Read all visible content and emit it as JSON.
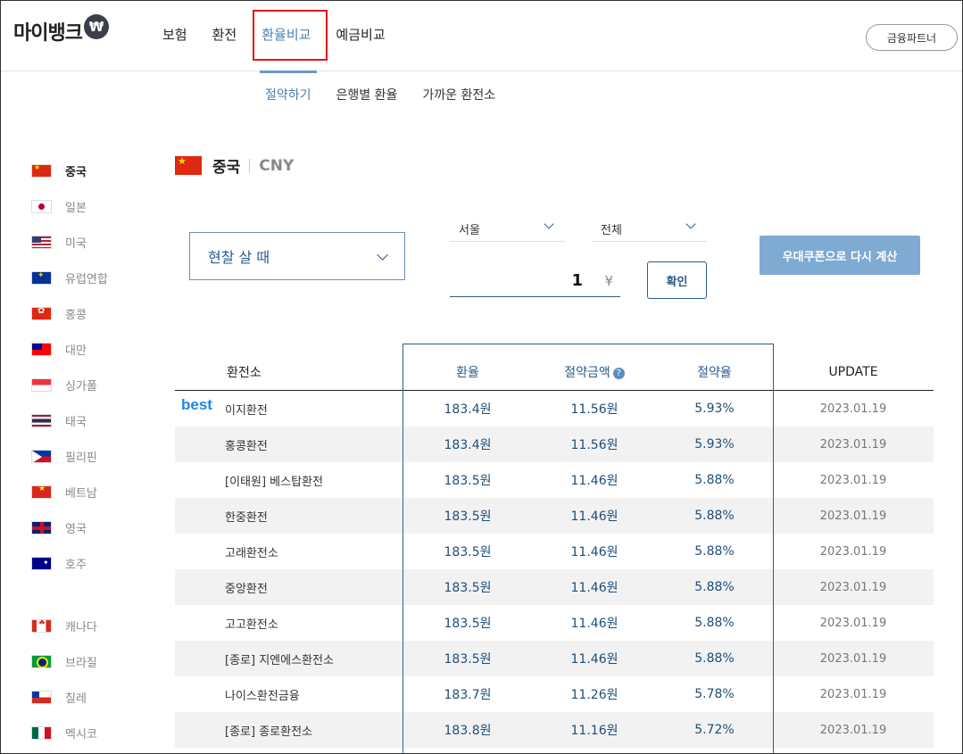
{
  "header": {
    "logo_text": "마이뱅크",
    "logo_badge": "₩",
    "nav": [
      "보험",
      "환전",
      "환율비교",
      "예금비교"
    ],
    "partner_label": "금융파트너"
  },
  "subnav": [
    "절약하기",
    "은행별 환율",
    "가까운 환전소"
  ],
  "sidebar": {
    "items": [
      {
        "label": "중국",
        "flag": "cn-flag"
      },
      {
        "label": "일본",
        "flag": "jp-flag"
      },
      {
        "label": "미국",
        "flag": "us-flag"
      },
      {
        "label": "유럽연합",
        "flag": "eu-flag"
      },
      {
        "label": "홍콩",
        "flag": "hk-flag"
      },
      {
        "label": "대만",
        "flag": "tw-flag"
      },
      {
        "label": "싱가폴",
        "flag": "sg-flag"
      },
      {
        "label": "태국",
        "flag": "th-flag"
      },
      {
        "label": "필리핀",
        "flag": "ph-flag"
      },
      {
        "label": "베트남",
        "flag": "vn-flag"
      },
      {
        "label": "영국",
        "flag": "gb-flag"
      },
      {
        "label": "호주",
        "flag": "au-flag"
      },
      {
        "label": "캐나다",
        "flag": "ca-flag"
      },
      {
        "label": "브라질",
        "flag": "br-flag"
      },
      {
        "label": "칠레",
        "flag": "cl-flag"
      },
      {
        "label": "멕시코",
        "flag": "mx-flag"
      }
    ]
  },
  "currency": {
    "name": "중국",
    "code": "CNY"
  },
  "controls": {
    "mode": "현찰 살 때",
    "region": "서울",
    "type": "전체",
    "amount": "1",
    "unit": "¥",
    "confirm": "확인",
    "coupon": "우대쿠폰으로 다시 계산"
  },
  "table": {
    "headers": {
      "shop": "환전소",
      "rate": "환율",
      "save": "절약금액",
      "pct": "절약율",
      "update": "UPDATE"
    },
    "best_label": "best",
    "rows": [
      {
        "shop": "이지환전",
        "rate": "183.4원",
        "save": "11.56원",
        "pct": "5.93%",
        "date": "2023.01.19"
      },
      {
        "shop": "홍콩환전",
        "rate": "183.4원",
        "save": "11.56원",
        "pct": "5.93%",
        "date": "2023.01.19"
      },
      {
        "shop": "[이태원] 베스탑환전",
        "rate": "183.5원",
        "save": "11.46원",
        "pct": "5.88%",
        "date": "2023.01.19"
      },
      {
        "shop": "한중환전",
        "rate": "183.5원",
        "save": "11.46원",
        "pct": "5.88%",
        "date": "2023.01.19"
      },
      {
        "shop": "고래환전소",
        "rate": "183.5원",
        "save": "11.46원",
        "pct": "5.88%",
        "date": "2023.01.19"
      },
      {
        "shop": "중앙환전",
        "rate": "183.5원",
        "save": "11.46원",
        "pct": "5.88%",
        "date": "2023.01.19"
      },
      {
        "shop": "고고환전소",
        "rate": "183.5원",
        "save": "11.46원",
        "pct": "5.88%",
        "date": "2023.01.19"
      },
      {
        "shop": "[종로] 지엔에스환전소",
        "rate": "183.5원",
        "save": "11.46원",
        "pct": "5.88%",
        "date": "2023.01.19"
      },
      {
        "shop": "나이스환전금융",
        "rate": "183.7원",
        "save": "11.26원",
        "pct": "5.78%",
        "date": "2023.01.19"
      },
      {
        "shop": "[종로] 종로환전소",
        "rate": "183.8원",
        "save": "11.16원",
        "pct": "5.72%",
        "date": "2023.01.19"
      }
    ]
  }
}
